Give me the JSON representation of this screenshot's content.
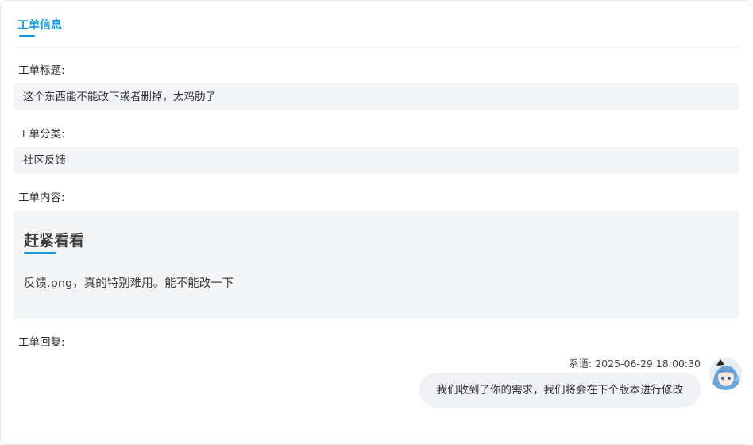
{
  "tabs": [
    {
      "label": "工单信息",
      "active": true
    }
  ],
  "fields": {
    "title": {
      "label": "工单标题:",
      "value": "这个东西能不能改下或者删掉，太鸡肋了"
    },
    "category": {
      "label": "工单分类:",
      "value": "社区反馈"
    },
    "content": {
      "label": "工单内容:",
      "heading": "赶紧看看",
      "body": "反馈.png，真的特别难用。能不能改一下"
    },
    "reply": {
      "label": "工单回复:"
    }
  },
  "replies": [
    {
      "author": "系语",
      "meta": "系语: 2025-06-29 18:00:30",
      "text": "我们收到了你的需求，我们将会在下个版本进行修改",
      "avatar_icon": "anime-avatar"
    }
  ],
  "colors": {
    "accent": "#1296db",
    "field_bg": "#f4f5f7",
    "bubble_bg": "#f1f2f5",
    "text": "#303133"
  }
}
